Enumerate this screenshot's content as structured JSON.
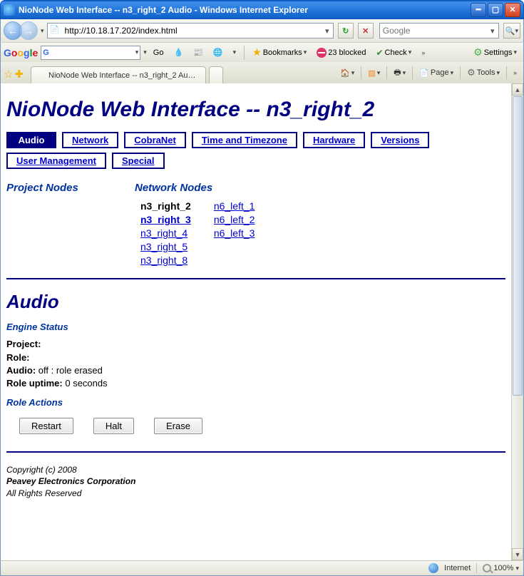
{
  "window": {
    "title": "NioNode Web Interface -- n3_right_2 Audio - Windows Internet Explorer"
  },
  "address": {
    "url": "http://10.18.17.202/index.html",
    "search_placeholder": "Google"
  },
  "google_toolbar": {
    "go": "Go",
    "bookmarks": "Bookmarks",
    "blocked": "23 blocked",
    "check": "Check",
    "settings": "Settings"
  },
  "tabstrip": {
    "tab1": "NioNode Web Interface -- n3_right_2 Audio",
    "page": "Page",
    "tools": "Tools"
  },
  "page": {
    "title": "NioNode Web Interface -- n3_right_2",
    "tabs": {
      "audio": "Audio",
      "network": "Network",
      "cobranet": "CobraNet",
      "time": "Time and Timezone",
      "hardware": "Hardware",
      "versions": "Versions",
      "usermgmt": "User Management",
      "special": "Special"
    },
    "project_nodes_h": "Project Nodes",
    "network_nodes_h": "Network Nodes",
    "nodes_left": {
      "n0": "n3_right_2",
      "n1": "n3_right_3",
      "n2": "n3_right_4",
      "n3": "n3_right_5",
      "n4": "n3_right_8"
    },
    "nodes_right": {
      "n0": "n6_left_1",
      "n1": "n6_left_2",
      "n2": "n6_left_3"
    },
    "section_h": "Audio",
    "engine_status_h": "Engine Status",
    "project_label": "Project:",
    "project_value": "",
    "role_label": "Role:",
    "role_value": "",
    "audio_label": "Audio:",
    "audio_value": "off : role erased",
    "uptime_label": "Role uptime:",
    "uptime_value": "0 seconds",
    "role_actions_h": "Role Actions",
    "btn_restart": "Restart",
    "btn_halt": "Halt",
    "btn_erase": "Erase",
    "footer_copy": "Copyright (c) 2008",
    "footer_corp": "Peavey Electronics Corporation",
    "footer_rights": "All Rights Reserved"
  },
  "status": {
    "zone": "Internet",
    "zoom": "100%"
  }
}
